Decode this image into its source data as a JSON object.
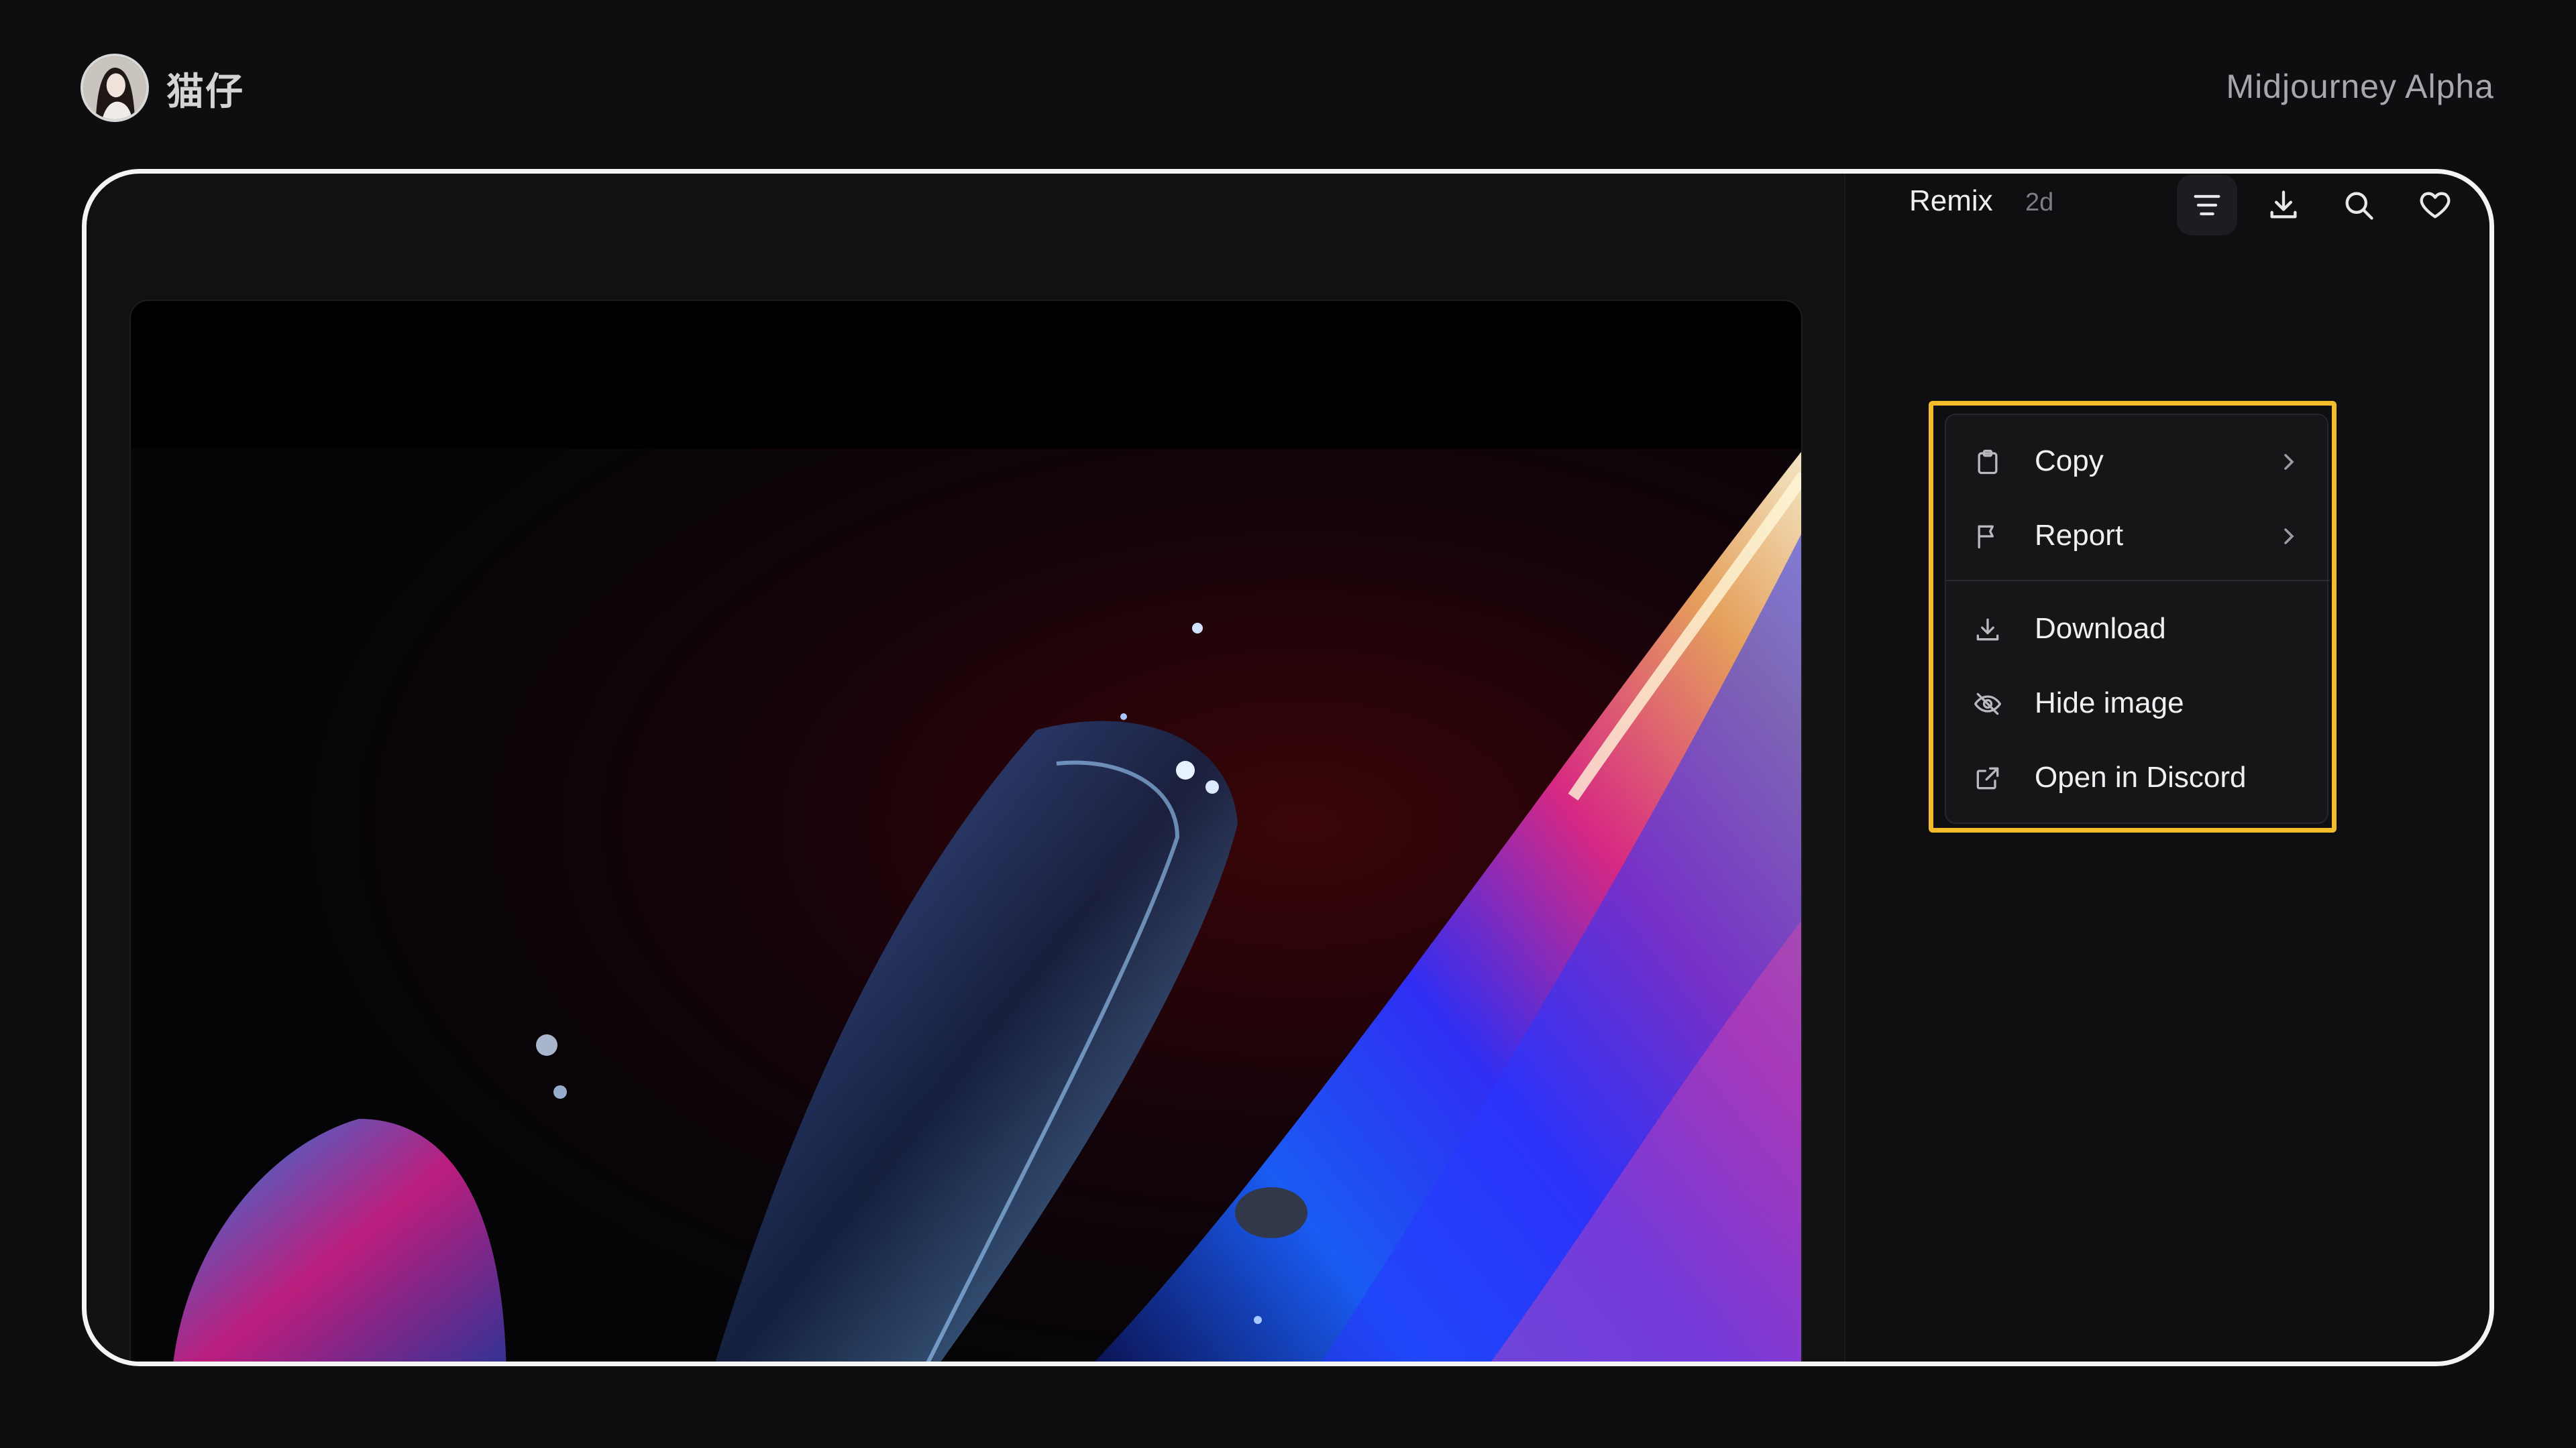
{
  "header": {
    "username": "猫仔",
    "brand": "Midjourney Alpha"
  },
  "toolbar": {
    "remix_label": "Remix",
    "age": "2d",
    "icons": [
      "menu-icon",
      "download-icon",
      "search-icon",
      "heart-icon"
    ]
  },
  "menu": {
    "items": [
      {
        "label": "Copy",
        "icon": "clipboard-icon",
        "submenu": true
      },
      {
        "label": "Report",
        "icon": "flag-icon",
        "submenu": true
      },
      {
        "label": "Download",
        "icon": "download-icon",
        "submenu": false
      },
      {
        "label": "Hide image",
        "icon": "eye-off-icon",
        "submenu": false
      },
      {
        "label": "Open in Discord",
        "icon": "external-link-icon",
        "submenu": false
      }
    ]
  },
  "colors": {
    "background": "#0e0e10",
    "frame_border": "#f4f4f4",
    "highlight": "#f4bb2a",
    "menu_bg": "#161619"
  }
}
